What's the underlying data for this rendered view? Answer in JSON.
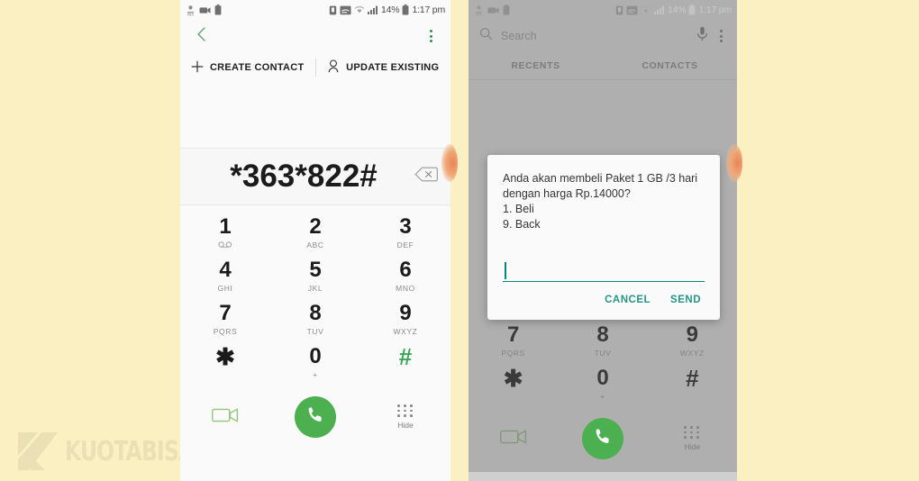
{
  "watermark": {
    "text": "KUOTABISA.COM",
    "logo_icon": "k-logo-icon"
  },
  "status_bar": {
    "left_icons": [
      "data-rate-icon",
      "video-recorder-icon",
      "battery-saver-icon"
    ],
    "right_icons": [
      "alarm-icon",
      "screen-cast-icon",
      "wifi-icon",
      "signal-bars-icon",
      "battery-icon"
    ],
    "battery_percent": "14%",
    "time": "1:17 pm"
  },
  "left_phone": {
    "nav": {
      "back_icon": "back-chevron-icon",
      "menu_icon": "kebab-menu-icon"
    },
    "actions": [
      {
        "label": "CREATE CONTACT",
        "icon": "plus-icon"
      },
      {
        "label": "UPDATE EXISTING",
        "icon": "person-icon"
      }
    ],
    "dialed_number": "*363*822#",
    "backspace_icon": "backspace-icon",
    "keypad": [
      [
        {
          "digit": "1",
          "sub": "",
          "sub_icon": "voicemail-icon",
          "active": false
        },
        {
          "digit": "2",
          "sub": "ABC",
          "active": false
        },
        {
          "digit": "3",
          "sub": "DEF",
          "active": false
        }
      ],
      [
        {
          "digit": "4",
          "sub": "GHI",
          "active": false
        },
        {
          "digit": "5",
          "sub": "JKL",
          "active": false
        },
        {
          "digit": "6",
          "sub": "MNO",
          "active": false
        }
      ],
      [
        {
          "digit": "7",
          "sub": "PQRS",
          "active": false
        },
        {
          "digit": "8",
          "sub": "TUV",
          "active": false
        },
        {
          "digit": "9",
          "sub": "WXYZ",
          "active": false
        }
      ],
      [
        {
          "digit": "✱",
          "sub": "",
          "active": false
        },
        {
          "digit": "0",
          "sub": "+",
          "active": false
        },
        {
          "digit": "#",
          "sub": "",
          "active": true
        }
      ]
    ],
    "bottom": {
      "video_call_icon": "video-call-icon",
      "call_icon": "call-handset-icon",
      "hide_label": "Hide",
      "hide_icon": "keypad-dots-icon"
    }
  },
  "right_phone": {
    "search": {
      "placeholder": "Search",
      "search_icon": "search-icon",
      "mic_icon": "microphone-icon",
      "menu_icon": "kebab-menu-icon"
    },
    "tabs": [
      {
        "label": "RECENTS"
      },
      {
        "label": "CONTACTS"
      }
    ],
    "keypad": [
      [
        {
          "digit": "7",
          "sub": "PQRS"
        },
        {
          "digit": "8",
          "sub": "TUV"
        },
        {
          "digit": "9",
          "sub": "WXYZ"
        }
      ],
      [
        {
          "digit": "✱",
          "sub": ""
        },
        {
          "digit": "0",
          "sub": "+"
        },
        {
          "digit": "#",
          "sub": ""
        }
      ]
    ],
    "bottom": {
      "video_call_icon": "video-call-icon",
      "call_icon": "call-handset-icon",
      "hide_label": "Hide",
      "hide_icon": "keypad-dots-icon"
    },
    "dialog": {
      "message": "Anda akan membeli Paket 1 GB /3 hari dengan harga Rp.14000?\n1. Beli\n9. Back",
      "input_value": "",
      "cancel_label": "CANCEL",
      "send_label": "SEND"
    }
  },
  "colors": {
    "background": "#fbf0c2",
    "panel": "#fafafa",
    "dim_panel": "#c9c9c9",
    "accent_green": "#4caf50",
    "accent_teal": "#249688",
    "edge_handle": "#e8845a"
  }
}
